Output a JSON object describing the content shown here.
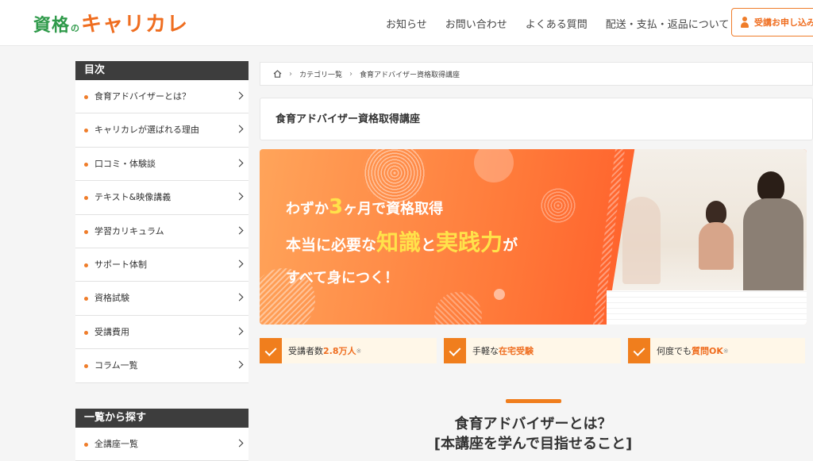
{
  "header": {
    "logo": {
      "part1": "資格",
      "part2": "の",
      "part3": "キャリカレ"
    },
    "nav": [
      "お知らせ",
      "お問い合わせ",
      "よくある質問",
      "配送・支払・返品について"
    ],
    "apply_button": "受講お申し込み"
  },
  "sidebar": {
    "toc_title": "目次",
    "toc_items": [
      "食育アドバイザーとは？",
      "キャリカレが選ばれる理由",
      "口コミ・体験談",
      "テキスト&映像講義",
      "学習カリキュラム",
      "サポート体制",
      "資格試験",
      "受講費用",
      "コラム一覧"
    ],
    "search_title": "一覧から探す",
    "search_items": [
      "全講座一覧"
    ]
  },
  "breadcrumb": {
    "category": "カテゴリ一覧",
    "current": "食育アドバイザー資格取得講座"
  },
  "page_title": "食育アドバイザー資格取得講座",
  "hero": {
    "line1_pre": "わずか",
    "line1_num": "3",
    "line1_post": "ヶ月で資格取得",
    "line2_pre": "本当に必要な",
    "line2_a": "知識",
    "line2_mid": "と",
    "line2_b": "実践力",
    "line2_post": "が",
    "line3": "すべて身につく！"
  },
  "features": [
    {
      "pre": "受講者数",
      "hl": "2.8万人",
      "post": "",
      "note": "※"
    },
    {
      "pre": "手軽な",
      "hl": "在宅受験",
      "post": "",
      "note": ""
    },
    {
      "pre": "何度でも",
      "hl": "質問OK",
      "post": "",
      "note": "※"
    }
  ],
  "section": {
    "title": "食育アドバイザーとは？",
    "subtitle": "[本講座を学んで目指せること]"
  },
  "colors": {
    "accent": "#ef6d1f",
    "brand_green": "#2f9a4a",
    "dark": "#3d3d3d"
  }
}
